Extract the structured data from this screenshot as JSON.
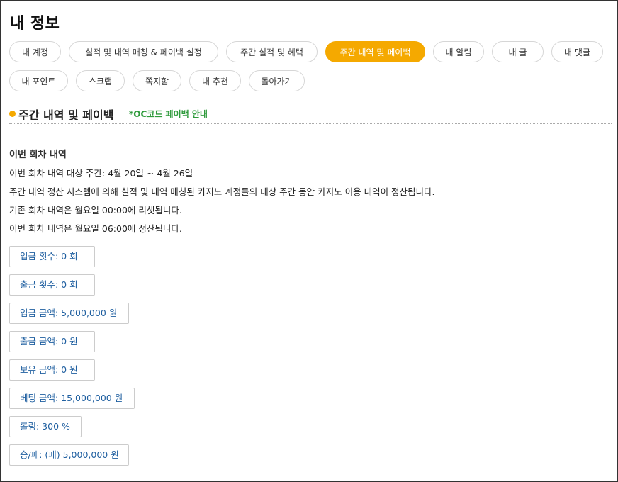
{
  "page": {
    "title": "내 정보"
  },
  "tabs": [
    {
      "label": "내 계정",
      "active": false
    },
    {
      "label": "실적 및 내역 매칭 & 페이백 설정",
      "active": false
    },
    {
      "label": "주간 실적 및 혜택",
      "active": false
    },
    {
      "label": "주간 내역 및 페이백",
      "active": true
    },
    {
      "label": "내 알림",
      "active": false
    },
    {
      "label": "내 글",
      "active": false
    },
    {
      "label": "내 댓글",
      "active": false
    },
    {
      "label": "내 포인트",
      "active": false
    },
    {
      "label": "스크랩",
      "active": false
    },
    {
      "label": "쪽지함",
      "active": false
    },
    {
      "label": "내 추천",
      "active": false
    },
    {
      "label": "돌아가기",
      "active": false
    }
  ],
  "section": {
    "title": "주간 내역 및 페이백",
    "link": "*OC코드 페이백 안내"
  },
  "info": {
    "subhead": "이번 회차 내역",
    "lines": [
      "이번 회차 내역 대상 주간: 4월 20일 ~ 4월 26일",
      "주간 내역 정산 시스템에 의해 실적 및 내역 매칭된 카지노 계정들의 대상 주간 동안 카지노 이용 내역이 정산됩니다.",
      "기존 회차 내역은 월요일 00:00에 리셋됩니다.",
      "이번 회차 내역은 월요일 06:00에 정산됩니다."
    ]
  },
  "stats": [
    "입금 횟수: 0 회",
    "출금 횟수: 0 회",
    "입금 금액: 5,000,000 원",
    "출금 금액: 0 원",
    "보유 금액: 0 원",
    "베팅 금액: 15,000,000 원",
    "롤링: 300 %",
    "승/패: (패) 5,000,000 원"
  ],
  "colors": {
    "accent": "#f5a900",
    "link": "#2e9a3b",
    "stat_text": "#1f5fa0"
  }
}
